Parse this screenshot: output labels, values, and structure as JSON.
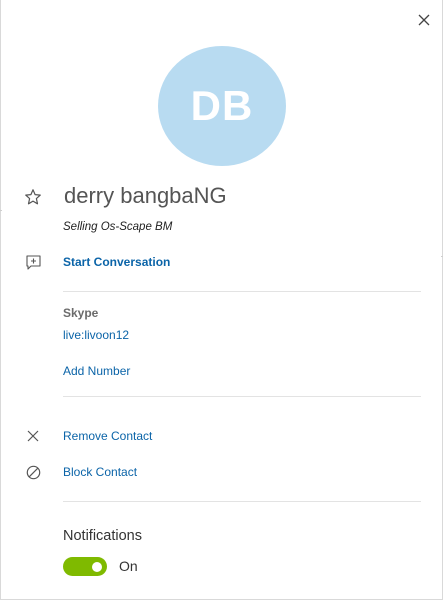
{
  "profile": {
    "initials": "DB",
    "name": "derry bangbaNG",
    "mood": "Selling Os-Scape BM",
    "avatar_color": "#b8dbf1"
  },
  "actions": {
    "start_conversation": "Start Conversation",
    "remove_contact": "Remove Contact",
    "block_contact": "Block Contact"
  },
  "contact_info": {
    "section_label": "Skype",
    "skype_id": "live:livoon12",
    "add_number": "Add Number"
  },
  "notifications": {
    "title": "Notifications",
    "state_label": "On",
    "enabled": true,
    "toggle_color": "#7fba00"
  },
  "colors": {
    "link": "#0b64a8",
    "divider": "#e3e3e3"
  },
  "icons": {
    "close": "close-icon",
    "favorite": "star-icon",
    "start_conversation": "chat-add-icon",
    "remove": "x-icon",
    "block": "block-icon"
  }
}
